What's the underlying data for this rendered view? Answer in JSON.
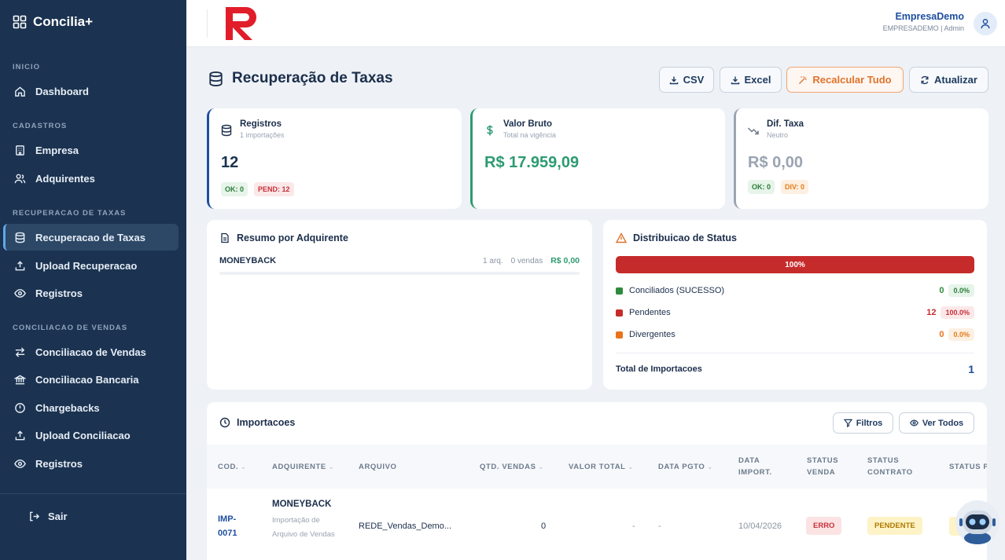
{
  "app": {
    "name": "Concilia+"
  },
  "sidebar": {
    "sections": [
      {
        "title": "INICIO",
        "items": [
          {
            "label": "Dashboard",
            "icon": "home-icon"
          }
        ]
      },
      {
        "title": "CADASTROS",
        "items": [
          {
            "label": "Empresa",
            "icon": "building-icon"
          },
          {
            "label": "Adquirentes",
            "icon": "users-icon"
          }
        ]
      },
      {
        "title": "RECUPERACAO DE TAXAS",
        "items": [
          {
            "label": "Recuperacao de Taxas",
            "icon": "database-icon",
            "active": true
          },
          {
            "label": "Upload Recuperacao",
            "icon": "upload-icon"
          },
          {
            "label": "Registros",
            "icon": "eye-icon"
          }
        ]
      },
      {
        "title": "CONCILIACAO DE VENDAS",
        "items": [
          {
            "label": "Conciliacao de Vendas",
            "icon": "swap-icon"
          },
          {
            "label": "Conciliacao Bancaria",
            "icon": "bank-icon"
          },
          {
            "label": "Chargebacks",
            "icon": "alert-circle-icon"
          },
          {
            "label": "Upload Conciliacao",
            "icon": "upload-icon"
          },
          {
            "label": "Registros",
            "icon": "eye-icon"
          }
        ]
      }
    ],
    "logout": "Sair"
  },
  "topbar": {
    "user_name": "EmpresaDemo",
    "user_sub": "EMPRESADEMO | Admin"
  },
  "page": {
    "title": "Recuperação de Taxas",
    "actions": {
      "csv": "CSV",
      "excel": "Excel",
      "recalc": "Recalcular Tudo",
      "refresh": "Atualizar"
    }
  },
  "stats": {
    "registros": {
      "title": "Registros",
      "sub": "1 importações",
      "value": "12",
      "chip_ok": "OK: 0",
      "chip_pend": "PEND: 12"
    },
    "valor_bruto": {
      "title": "Valor Bruto",
      "sub": "Total na vigência",
      "value": "R$ 17.959,09"
    },
    "dif_taxa": {
      "title": "Dif. Taxa",
      "sub": "Neutro",
      "value": "R$ 0,00",
      "chip_ok": "OK: 0",
      "chip_div": "DIV: 0"
    }
  },
  "resumo": {
    "title": "Resumo por Adquirente",
    "rows": [
      {
        "name": "MONEYBACK",
        "arq": "1 arq.",
        "vendas": "0 vendas",
        "valor": "R$ 0,00"
      }
    ]
  },
  "distribuicao": {
    "title": "Distribuicao de Status",
    "bar_label": "100%",
    "pendentes_fraction": 1.0,
    "rows": [
      {
        "label": "Conciliados (SUCESSO)",
        "count": "0",
        "pct": "0.0%",
        "color": "#2e8b3d"
      },
      {
        "label": "Pendentes",
        "count": "12",
        "pct": "100.0%",
        "color": "#c62b2b"
      },
      {
        "label": "Divergentes",
        "count": "0",
        "pct": "0.0%",
        "color": "#e8731a"
      }
    ],
    "total_label": "Total de Importacoes",
    "total_value": "1"
  },
  "importacoes": {
    "title": "Importacoes",
    "filters": "Filtros",
    "view_all": "Ver Todos",
    "headers": {
      "cod": "COD.",
      "adquirente": "ADQUIRENTE",
      "arquivo": "ARQUIVO",
      "qtd": "QTD. VENDAS",
      "valor": "VALOR TOTAL",
      "data_pgto": "DATA PGTO",
      "data_import": "DATA IMPORT.",
      "status_venda": "STATUS VENDA",
      "status_contrato": "STATUS CONTRATO",
      "status_p": "STATUS P"
    },
    "rows": [
      {
        "cod": "IMP-0071",
        "adquirente": "MONEYBACK",
        "descricao": "Importação de Arquivo de Vendas",
        "arquivo": "REDE_Vendas_Demo...",
        "qtd": "0",
        "valor": "-",
        "data_pgto": "-",
        "data_import": "10/04/2026",
        "status_venda": "ERRO",
        "status_contrato": "PENDENTE"
      }
    ]
  }
}
